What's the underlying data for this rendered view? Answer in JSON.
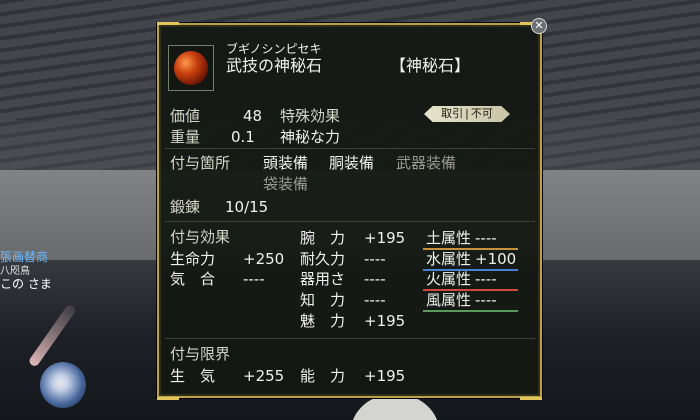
{
  "item": {
    "reading": "ブギノシンピセキ",
    "name": "武技の神秘石",
    "category": "【神秘石】",
    "icon": "red-orb-icon"
  },
  "value_label": "価値",
  "value": "48",
  "weight_label": "重量",
  "weight": "0.1",
  "special_effect_label": "特殊効果",
  "special_effect": "神秘な力",
  "trade_badge": {
    "left": "取引",
    "right": "不可"
  },
  "attach": {
    "label": "付与箇所",
    "slot1": "頭装備",
    "slot2": "胴装備",
    "slot3": "武器装備",
    "slot4": "袋装備"
  },
  "forge": {
    "label": "鍛錬",
    "value": "10/15"
  },
  "effects": {
    "label": "付与効果",
    "left": [
      {
        "name": "生命力",
        "value": "+250"
      },
      {
        "name": "気　合",
        "value": "----"
      }
    ],
    "middle": [
      {
        "name": "腕　力",
        "value": "+195"
      },
      {
        "name": "耐久力",
        "value": "----"
      },
      {
        "name": "器用さ",
        "value": "----"
      },
      {
        "name": "知　力",
        "value": "----"
      },
      {
        "name": "魅　力",
        "value": "+195"
      }
    ],
    "right": [
      {
        "name": "土属性",
        "value": "----",
        "color": "#c8923a"
      },
      {
        "name": "水属性",
        "value": "+100",
        "color": "#4a7fd6"
      },
      {
        "name": "火属性",
        "value": "----",
        "color": "#d2483a"
      },
      {
        "name": "風属性",
        "value": "----",
        "color": "#5a9a5a"
      }
    ]
  },
  "limits": {
    "label": "付与限界",
    "items": [
      {
        "name": "生　気",
        "value": "+255"
      },
      {
        "name": "能　力",
        "value": "+195"
      }
    ]
  },
  "scene": {
    "npc_title": "張画替商",
    "npc_sub": "八咫鳥",
    "npc_name": "この さま"
  },
  "colors": {
    "border": "#b9a24a",
    "panel": "#14180f",
    "text": "#f1f1f1"
  }
}
